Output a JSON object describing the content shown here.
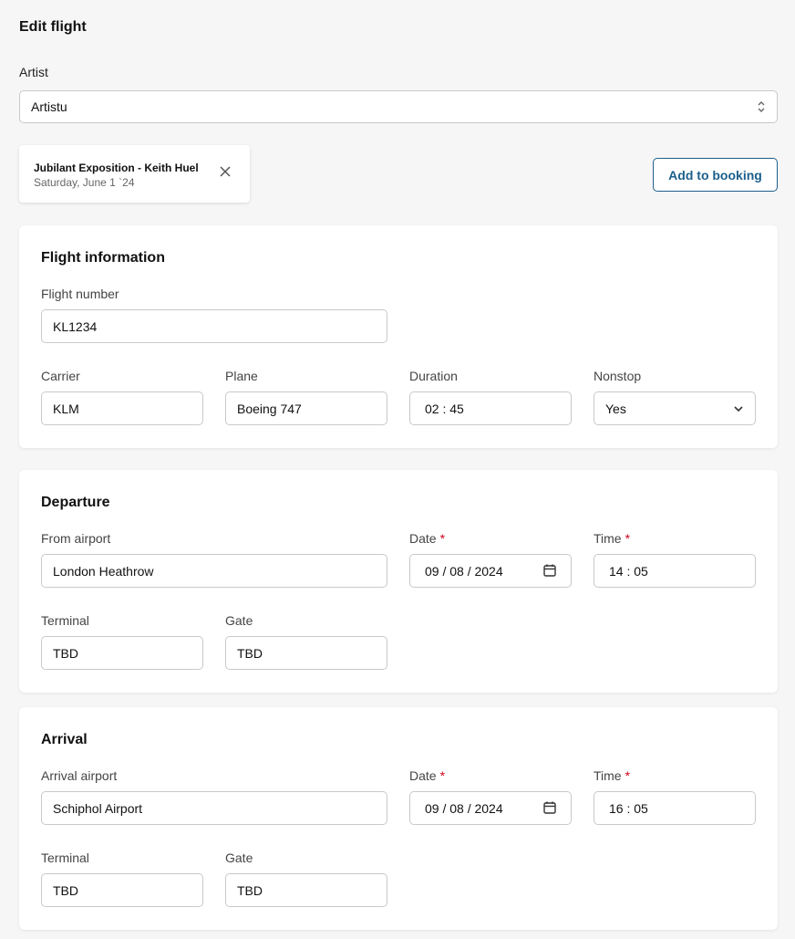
{
  "page": {
    "title": "Edit flight"
  },
  "artist": {
    "label": "Artist",
    "value": "Artistu"
  },
  "event": {
    "title": "Jubilant Exposition - Keith Huel",
    "date": "Saturday, June 1 `24"
  },
  "actions": {
    "add_to_booking": "Add to booking"
  },
  "flight_info": {
    "title": "Flight information",
    "flight_number": {
      "label": "Flight number",
      "value": "KL1234"
    },
    "carrier": {
      "label": "Carrier",
      "value": "KLM"
    },
    "plane": {
      "label": "Plane",
      "value": "Boeing 747"
    },
    "duration": {
      "label": "Duration",
      "value": "02 : 45"
    },
    "nonstop": {
      "label": "Nonstop",
      "value": "Yes"
    }
  },
  "departure": {
    "title": "Departure",
    "airport": {
      "label": "From airport",
      "value": "London Heathrow"
    },
    "date": {
      "label": "Date",
      "required": "*",
      "value": "09 / 08 / 2024"
    },
    "time": {
      "label": "Time",
      "required": "*",
      "value": "14 : 05"
    },
    "terminal": {
      "label": "Terminal",
      "value": "TBD"
    },
    "gate": {
      "label": "Gate",
      "value": "TBD"
    }
  },
  "arrival": {
    "title": "Arrival",
    "airport": {
      "label": "Arrival airport",
      "value": "Schiphol Airport"
    },
    "date": {
      "label": "Date",
      "required": "*",
      "value": "09 / 08 / 2024"
    },
    "time": {
      "label": "Time",
      "required": "*",
      "value": "16 : 05"
    },
    "terminal": {
      "label": "Terminal",
      "value": "TBD"
    },
    "gate": {
      "label": "Gate",
      "value": "TBD"
    }
  },
  "colors": {
    "accent": "#1c5f8b",
    "required": "#d0021b",
    "border": "#c9c9c9"
  },
  "icons": {
    "select": "chevron-updown-icon",
    "dropdown": "chevron-down-icon",
    "calendar": "calendar-icon",
    "close": "close-icon"
  }
}
